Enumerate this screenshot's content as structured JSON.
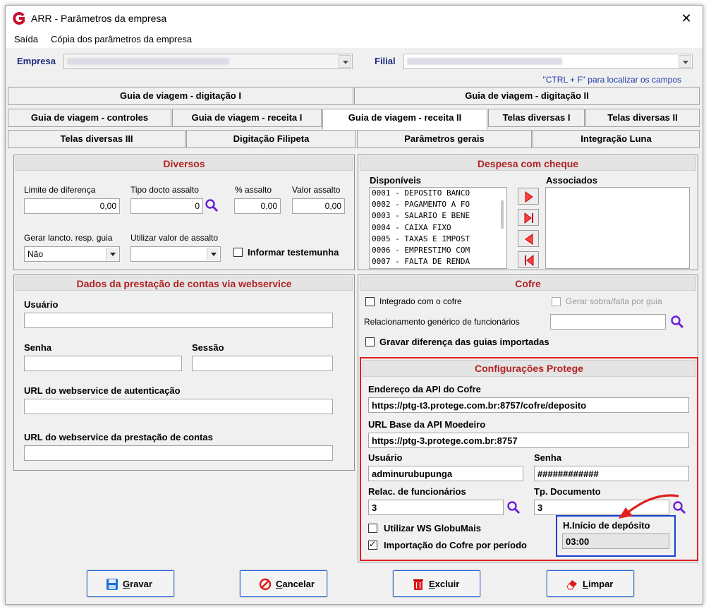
{
  "window": {
    "title": "ARR - Parâmetros da empresa",
    "close": "✕"
  },
  "menu": {
    "items": [
      "Saída",
      "Cópia dos parâmetros da empresa"
    ]
  },
  "empresa": {
    "label": "Empresa",
    "filial_label": "Filial",
    "ctrl_f_hint": "\"CTRL + F\" para localizar os campos"
  },
  "tabs": {
    "row1": [
      "Guia de viagem - digitação I",
      "Guia de viagem - digitação II"
    ],
    "row2": [
      "Guia de viagem - controles",
      "Guia de viagem - receita I",
      "Guia de viagem - receita II",
      "Telas diversas I",
      "Telas diversas II"
    ],
    "row3": [
      "Telas diversas III",
      "Digitação Filipeta",
      "Parâmetros gerais",
      "Integração Luna"
    ],
    "active": "Guia de viagem - receita II"
  },
  "diversos": {
    "title": "Diversos",
    "limite_label": "Limite de diferença",
    "limite_value": "0,00",
    "tipo_label": "Tipo docto assalto",
    "tipo_value": "0",
    "pct_label": "% assalto",
    "pct_value": "0,00",
    "valor_label": "Valor assalto",
    "valor_value": "0,00",
    "gerar_label": "Gerar lancto. resp. guia",
    "gerar_value": "Não",
    "utilizar_label": "Utilizar valor de assalto",
    "utilizar_value": "",
    "informar_label": "Informar testemunha"
  },
  "webservice": {
    "title": "Dados da prestação de contas via webservice",
    "usuario_label": "Usuário",
    "senha_label": "Senha",
    "sessao_label": "Sessão",
    "url_auth_label": "URL do webservice de autenticação",
    "url_prest_label": "URL do webservice da prestação de contas"
  },
  "despesa": {
    "title": "Despesa com cheque",
    "disponiveis_label": "Disponíveis",
    "associados_label": "Associados",
    "disponiveis": [
      "0001 - DEPOSITO BANCO",
      "0002 - PAGAMENTO A FO",
      "0003 - SALARIO E BENE",
      "0004 - CAIXA FIXO",
      "0005 - TAXAS E IMPOST",
      "0006 - EMPRESTIMO COM",
      "0007 - FALTA DE RENDA"
    ]
  },
  "cofre": {
    "title": "Cofre",
    "integrado_label": "Integrado com o cofre",
    "gerar_sobra_label": "Gerar sobra/falta por guia",
    "relac_label": "Relacionamento genérico de funcionários",
    "gravar_dif_label": "Gravar diferença das guias importadas"
  },
  "protege": {
    "title": "Configurações Protege",
    "endereco_label": "Endereço da API do Cofre",
    "endereco_value": "https://ptg-t3.protege.com.br:8757/cofre/deposito",
    "url_base_label": "URL Base da API Moedeiro",
    "url_base_value": "https://ptg-3.protege.com.br:8757",
    "usuario_label": "Usuário",
    "usuario_value": "adminurubupunga",
    "senha_label": "Senha",
    "senha_value": "############",
    "relac_label": "Relac. de funcionários",
    "relac_value": "3",
    "tp_label": "Tp. Documento",
    "tp_value": "3",
    "utilizar_ws_label": "Utilizar WS GlobuMais",
    "importacao_label": "Importação do Cofre por período",
    "h_inicio_label": "H.Início de depósito",
    "h_inicio_value": "03:00"
  },
  "buttons": {
    "gravar_u": "G",
    "gravar_rest": "ravar",
    "cancelar_u": "C",
    "cancelar_rest": "ancelar",
    "excluir_u": "E",
    "excluir_rest": "xcluir",
    "limpar_u": "L",
    "limpar_rest": "impar"
  },
  "colors": {
    "header_red": "#b22222",
    "highlight_red": "#e02020",
    "highlight_blue": "#1a3fd0"
  }
}
